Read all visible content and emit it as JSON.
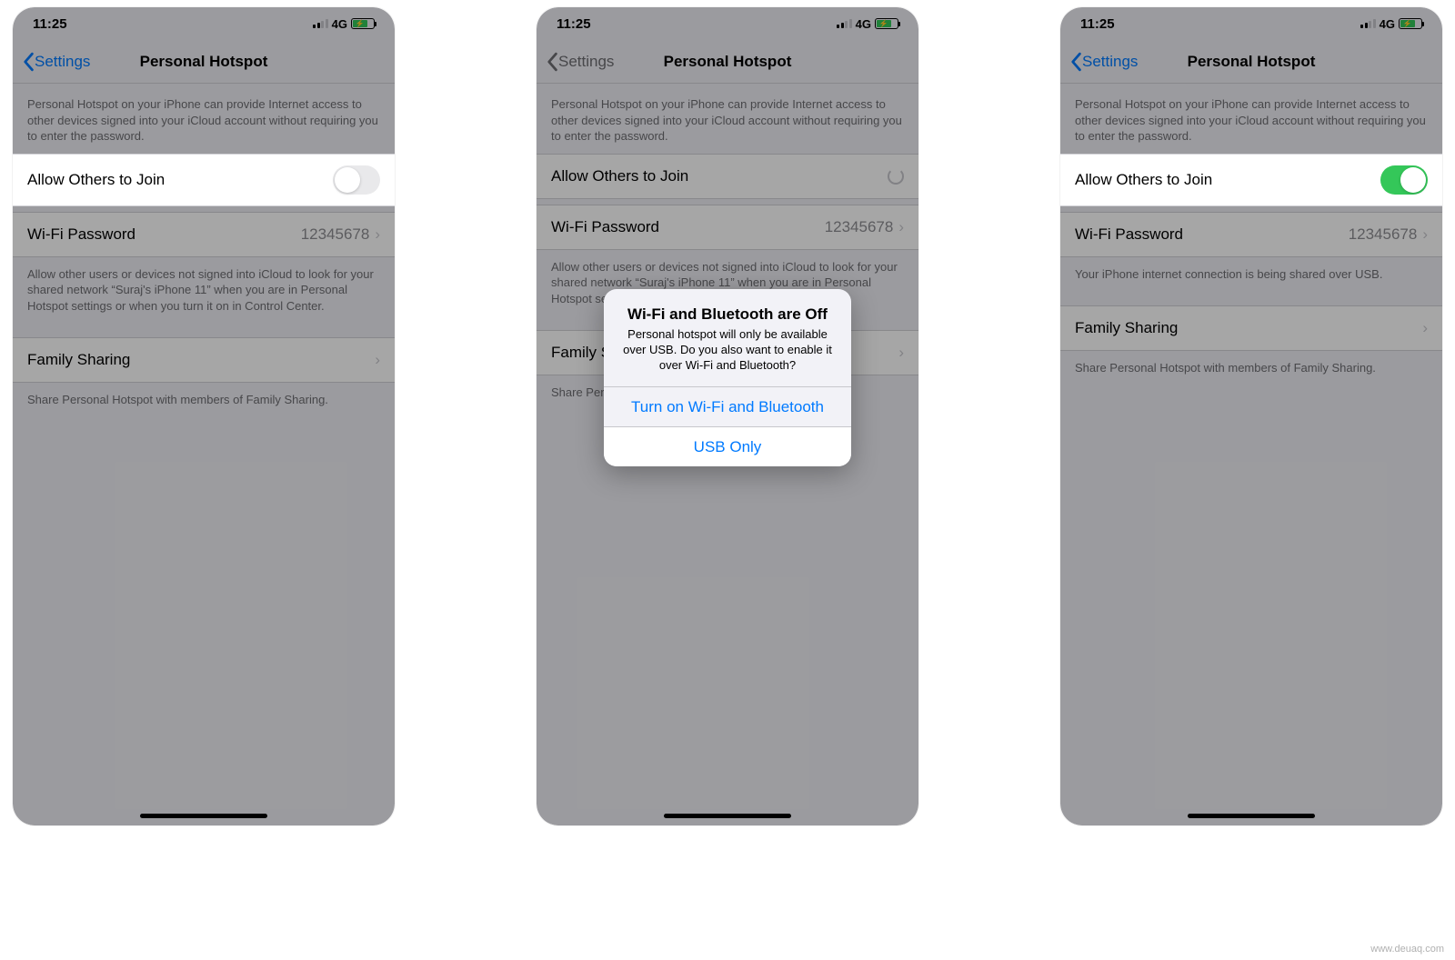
{
  "status": {
    "time": "11:25",
    "network": "4G"
  },
  "nav": {
    "back": "Settings",
    "title": "Personal Hotspot"
  },
  "intro": "Personal Hotspot on your iPhone can provide Internet access to other devices signed into your iCloud account without requiring you to enter the password.",
  "allow_label": "Allow Others to Join",
  "wifi_pw_label": "Wi-Fi Password",
  "wifi_pw_value": "12345678",
  "footer1_off": "Allow other users or devices not signed into iCloud to look for your shared network “Suraj's iPhone 11” when you are in Personal Hotspot settings or when you turn it on in Control Center.",
  "footer1_on": "Your iPhone internet connection is being shared over USB.",
  "family_label": "Family Sharing",
  "family_footer": "Share Personal Hotspot with members of Family Sharing.",
  "alert": {
    "title": "Wi-Fi and Bluetooth are Off",
    "msg": "Personal hotspot will only be available over USB. Do you also want to enable it over Wi-Fi and Bluetooth?",
    "opt1": "Turn on Wi-Fi and Bluetooth",
    "opt2": "USB Only"
  },
  "watermark": "www.deuaq.com"
}
